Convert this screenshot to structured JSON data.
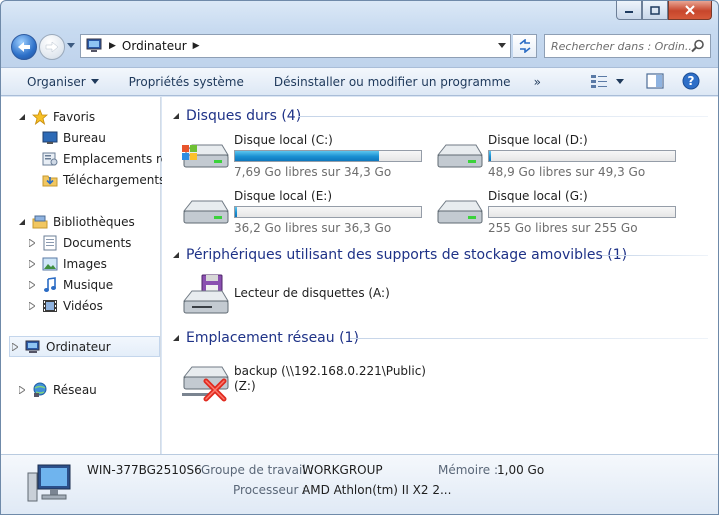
{
  "window": {
    "address_crumb": "Ordinateur",
    "search_placeholder": "Rechercher dans : Ordin..."
  },
  "toolbar": {
    "items": [
      "Organiser",
      "Propriétés système",
      "Désinstaller ou modifier un programme"
    ],
    "more_label": "»"
  },
  "nav": {
    "favorites_label": "Favoris",
    "favorites": [
      "Bureau",
      "Emplacements réce",
      "Téléchargements"
    ],
    "libraries_label": "Bibliothèques",
    "libraries": [
      "Documents",
      "Images",
      "Musique",
      "Vidéos"
    ],
    "computer_label": "Ordinateur",
    "network_label": "Réseau"
  },
  "content": {
    "hard_disks_title": "Disques durs (4)",
    "drives": [
      {
        "name": "Disque local (C:)",
        "free": "7,69 Go libres sur 34,3 Go",
        "used_fraction": 0.776,
        "icon": "windows-drive-icon"
      },
      {
        "name": "Disque local (D:)",
        "free": "48,9 Go libres sur 49,3 Go",
        "used_fraction": 0.008,
        "icon": "hard-drive-icon"
      },
      {
        "name": "Disque local (E:)",
        "free": "36,2 Go libres sur 36,3 Go",
        "used_fraction": 0.003,
        "icon": "hard-drive-icon"
      },
      {
        "name": "Disque local (G:)",
        "free": "255 Go libres sur 255 Go",
        "used_fraction": 0.0,
        "icon": "hard-drive-icon"
      }
    ],
    "removable_title": "Périphériques utilisant des supports de stockage amovibles (1)",
    "floppy_label": "Lecteur de disquettes (A:)",
    "network_title": "Emplacement réseau (1)",
    "network_drive_line1": "backup (\\\\192.168.0.221\\Public)",
    "network_drive_line2": "(Z:)"
  },
  "details": {
    "computer_name": "WIN-377BG2510S6",
    "workgroup_label": "Groupe de travail :",
    "workgroup_value": "WORKGROUP",
    "memory_label": "Mémoire :",
    "memory_value": "1,00 Go",
    "processor_label": "Processeur :",
    "processor_value": "AMD Athlon(tm) II X2 2..."
  },
  "colors": {
    "group_title": "#1e3287",
    "bar_fill": "#1a8fd2",
    "close_button": "#c7462c"
  }
}
